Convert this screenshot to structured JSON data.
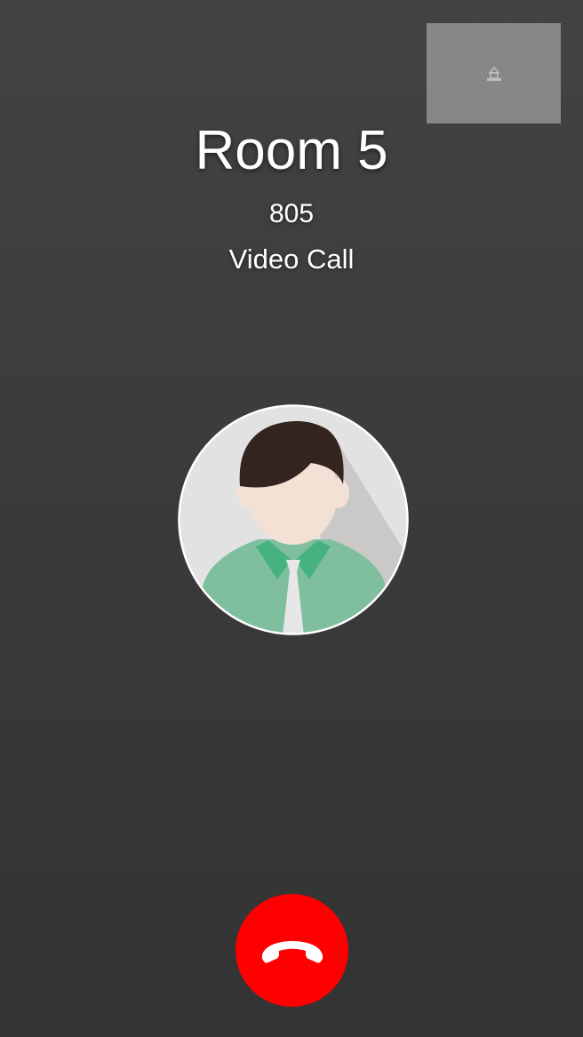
{
  "call": {
    "caller_name": "Room 5",
    "caller_number": "805",
    "call_type": "Video Call"
  },
  "icons": {
    "self_preview": "camera-placeholder-icon",
    "avatar": "person-avatar-icon",
    "end_call": "phone-hangup-icon"
  },
  "colors": {
    "end_call": "#ff0000",
    "preview_bg": "#878787",
    "shirt": "#7fbf9f",
    "collar": "#45b27f",
    "hair": "#33241f",
    "skin": "#f3e1d5"
  }
}
